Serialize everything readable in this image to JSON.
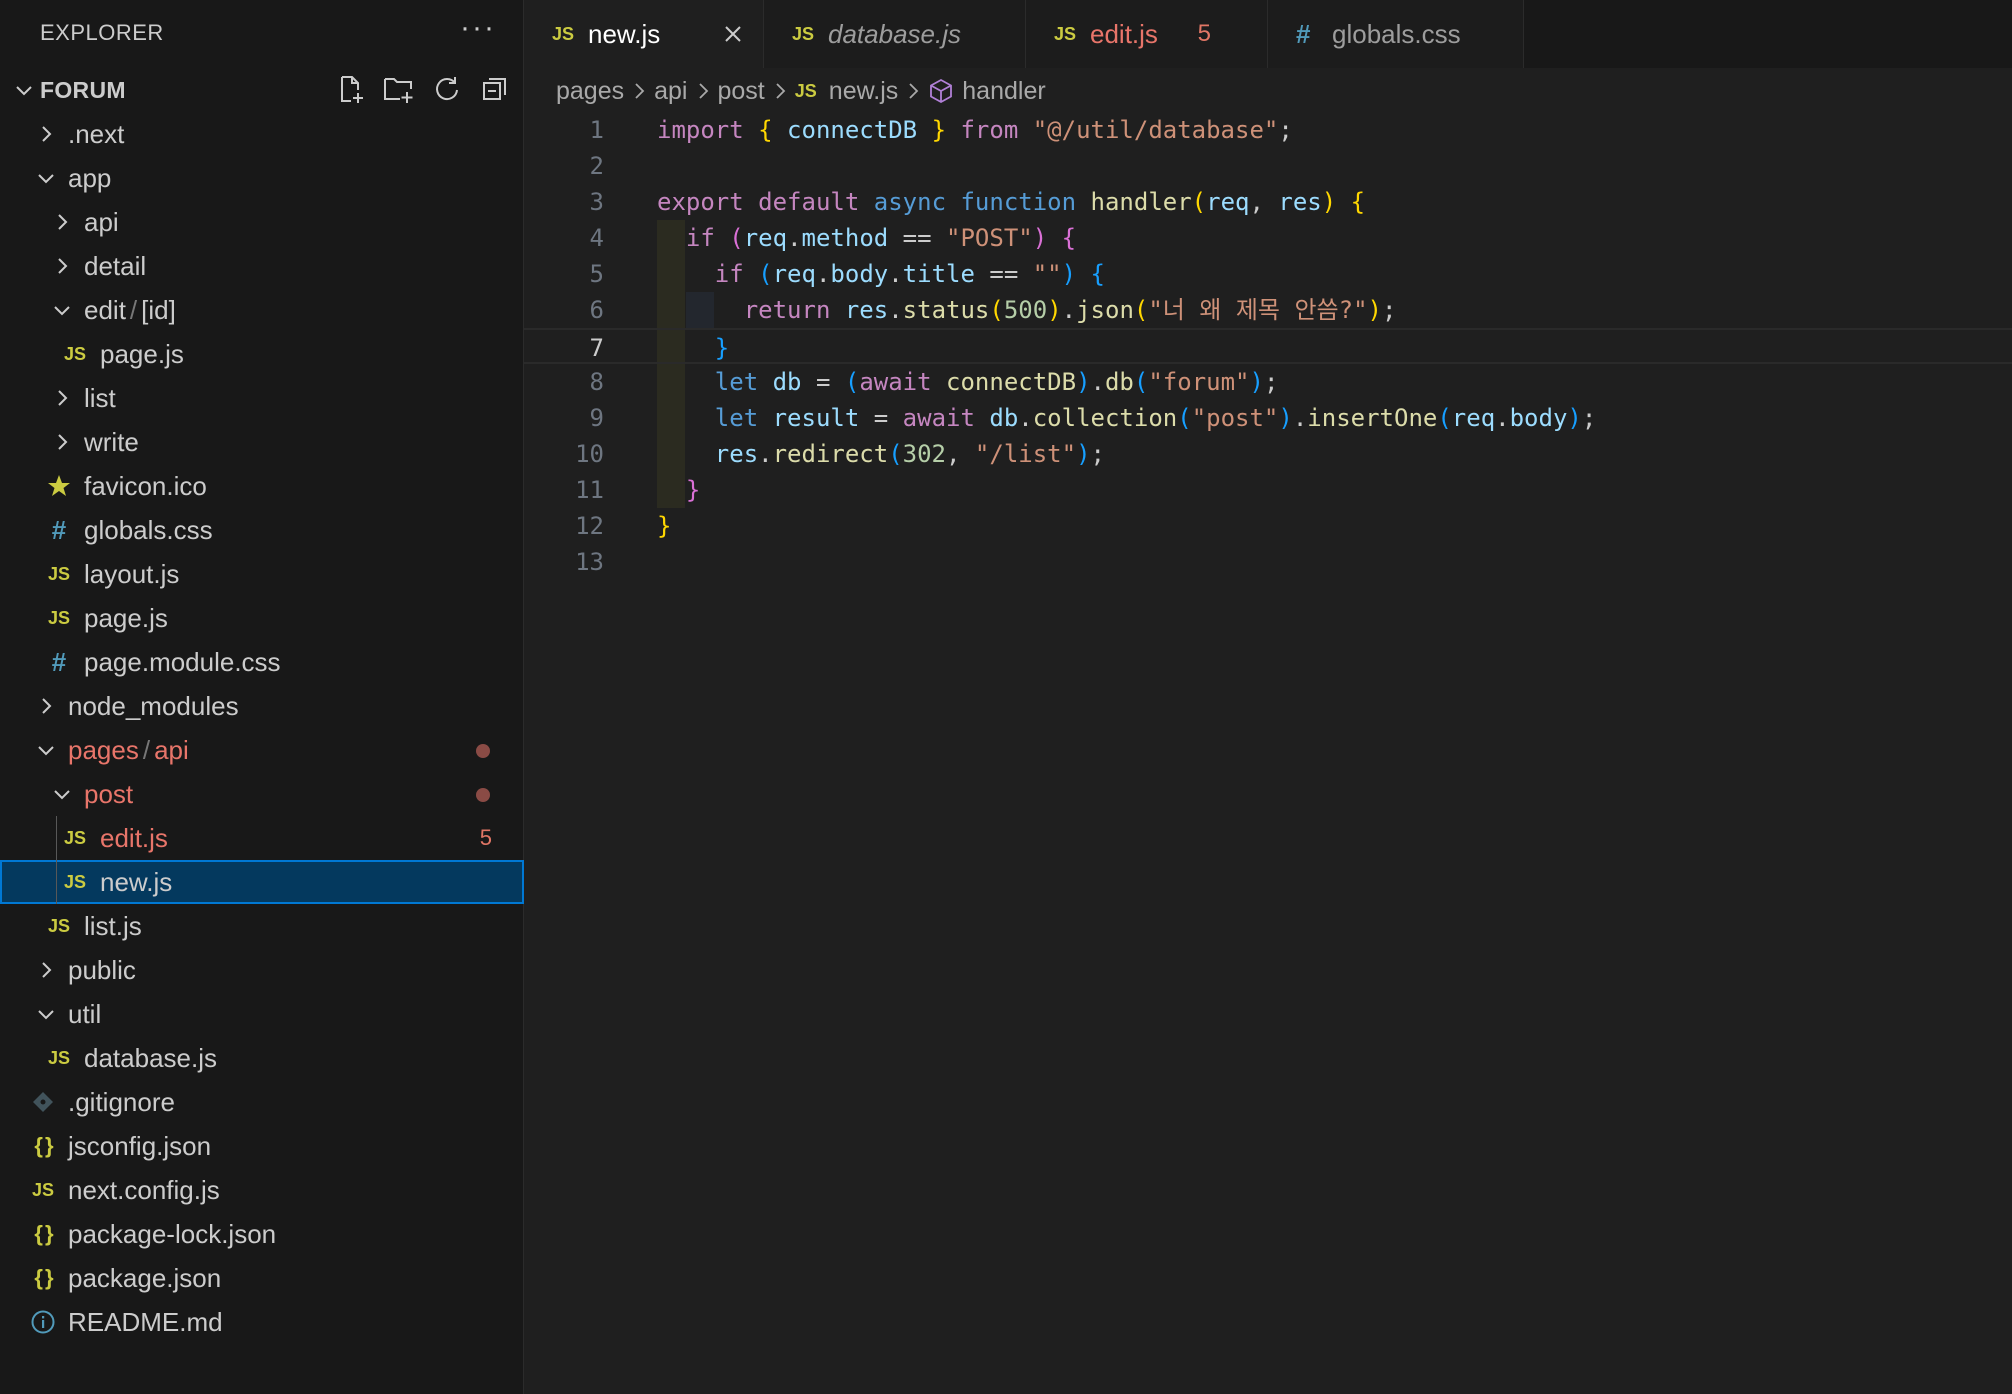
{
  "explorer": {
    "title": "EXPLORER",
    "more": "···",
    "workspace": "FORUM",
    "tree": [
      {
        "label": ".next",
        "type": "folder",
        "expanded": false,
        "depth": 0
      },
      {
        "label": "app",
        "type": "folder",
        "expanded": true,
        "depth": 0
      },
      {
        "label": "api",
        "type": "folder",
        "expanded": false,
        "depth": 1
      },
      {
        "label": "detail",
        "type": "folder",
        "expanded": false,
        "depth": 1
      },
      {
        "label": "edit",
        "label2": "[id]",
        "sep": "/",
        "type": "folder",
        "expanded": true,
        "depth": 1
      },
      {
        "label": "page.js",
        "type": "js",
        "depth": 2
      },
      {
        "label": "list",
        "type": "folder",
        "expanded": false,
        "depth": 1
      },
      {
        "label": "write",
        "type": "folder",
        "expanded": false,
        "depth": 1
      },
      {
        "label": "favicon.ico",
        "type": "ico",
        "depth": 1
      },
      {
        "label": "globals.css",
        "type": "css",
        "depth": 1
      },
      {
        "label": "layout.js",
        "type": "js",
        "depth": 1
      },
      {
        "label": "page.js",
        "type": "js",
        "depth": 1
      },
      {
        "label": "page.module.css",
        "type": "css",
        "depth": 1
      },
      {
        "label": "node_modules",
        "type": "folder",
        "expanded": false,
        "depth": 0
      },
      {
        "label": "pages",
        "label2": "api",
        "sep": "/",
        "type": "folder",
        "expanded": true,
        "depth": 0,
        "error": true,
        "dot": true
      },
      {
        "label": "post",
        "type": "folder",
        "expanded": true,
        "depth": 1,
        "error": true,
        "dot": true
      },
      {
        "label": "edit.js",
        "type": "js",
        "depth": 2,
        "error": true,
        "badge": "5"
      },
      {
        "label": "new.js",
        "type": "js",
        "depth": 2,
        "selected": true
      },
      {
        "label": "list.js",
        "type": "js",
        "depth": 1
      },
      {
        "label": "public",
        "type": "folder",
        "expanded": false,
        "depth": 0
      },
      {
        "label": "util",
        "type": "folder",
        "expanded": true,
        "depth": 0
      },
      {
        "label": "database.js",
        "type": "js",
        "depth": 1
      },
      {
        "label": ".gitignore",
        "type": "git",
        "depth": 0
      },
      {
        "label": "jsconfig.json",
        "type": "json",
        "depth": 0
      },
      {
        "label": "next.config.js",
        "type": "js",
        "depth": 0
      },
      {
        "label": "package-lock.json",
        "type": "json",
        "depth": 0
      },
      {
        "label": "package.json",
        "type": "json",
        "depth": 0
      },
      {
        "label": "README.md",
        "type": "info",
        "depth": 0
      }
    ]
  },
  "tabs": [
    {
      "label": "new.js",
      "icon": "JS",
      "active": true
    },
    {
      "label": "database.js",
      "icon": "JS",
      "italic": true
    },
    {
      "label": "edit.js",
      "icon": "JS",
      "error": true,
      "badge": "5"
    },
    {
      "label": "globals.css",
      "icon": "#"
    }
  ],
  "breadcrumb": [
    "pages",
    "api",
    "post",
    "new.js",
    "handler"
  ],
  "icons": {
    "js": "JS",
    "css": "#",
    "json": "{ }"
  },
  "colors": {
    "js_icon": "#cbcb41",
    "css_icon": "#519aba",
    "error": "#e17665",
    "selection": "#04395e",
    "focus_border": "#0078d4"
  },
  "editor": {
    "current_line": 7,
    "lines": [
      {
        "n": "1",
        "tokens": [
          [
            "import",
            "kw"
          ],
          [
            " ",
            "pl"
          ],
          [
            "{",
            "p1"
          ],
          [
            " connectDB ",
            "vr"
          ],
          [
            "}",
            "p1"
          ],
          [
            " ",
            "pl"
          ],
          [
            "from",
            "kw"
          ],
          [
            " ",
            "pl"
          ],
          [
            "\"@/util/database\"",
            "str"
          ],
          [
            ";",
            "pl"
          ]
        ]
      },
      {
        "n": "2",
        "tokens": []
      },
      {
        "n": "3",
        "tokens": [
          [
            "export",
            "kw"
          ],
          [
            " ",
            "pl"
          ],
          [
            "default",
            "kw"
          ],
          [
            " ",
            "pl"
          ],
          [
            "async",
            "kb"
          ],
          [
            " ",
            "pl"
          ],
          [
            "function",
            "kb"
          ],
          [
            " ",
            "pl"
          ],
          [
            "handler",
            "fn"
          ],
          [
            "(",
            "p1"
          ],
          [
            "req",
            "vr"
          ],
          [
            ", ",
            "pl"
          ],
          [
            "res",
            "vr"
          ],
          [
            ")",
            "p1"
          ],
          [
            " ",
            "pl"
          ],
          [
            "{",
            "p1"
          ]
        ]
      },
      {
        "n": "4",
        "tokens": [
          [
            "  ",
            "pl"
          ],
          [
            "if",
            "kw"
          ],
          [
            " ",
            "pl"
          ],
          [
            "(",
            "p2"
          ],
          [
            "req",
            "vr"
          ],
          [
            ".",
            "pl"
          ],
          [
            "method",
            "vr"
          ],
          [
            " == ",
            "pl"
          ],
          [
            "\"POST\"",
            "str"
          ],
          [
            ")",
            "p2"
          ],
          [
            " ",
            "pl"
          ],
          [
            "{",
            "p2"
          ]
        ]
      },
      {
        "n": "5",
        "tokens": [
          [
            "    ",
            "pl"
          ],
          [
            "if",
            "kw"
          ],
          [
            " ",
            "pl"
          ],
          [
            "(",
            "p3"
          ],
          [
            "req",
            "vr"
          ],
          [
            ".",
            "pl"
          ],
          [
            "body",
            "vr"
          ],
          [
            ".",
            "pl"
          ],
          [
            "title",
            "vr"
          ],
          [
            " == ",
            "pl"
          ],
          [
            "\"\"",
            "str"
          ],
          [
            ")",
            "p3"
          ],
          [
            " ",
            "pl"
          ],
          [
            "{",
            "p3"
          ]
        ]
      },
      {
        "n": "6",
        "tokens": [
          [
            "      ",
            "pl"
          ],
          [
            "return",
            "kw"
          ],
          [
            " ",
            "pl"
          ],
          [
            "res",
            "vr"
          ],
          [
            ".",
            "pl"
          ],
          [
            "status",
            "fn"
          ],
          [
            "(",
            "p1"
          ],
          [
            "500",
            "num"
          ],
          [
            ")",
            "p1"
          ],
          [
            ".",
            "pl"
          ],
          [
            "json",
            "fn"
          ],
          [
            "(",
            "p1"
          ],
          [
            "\"너 왜 제목 안씀?\"",
            "str"
          ],
          [
            ")",
            "p1"
          ],
          [
            ";",
            "pl"
          ]
        ]
      },
      {
        "n": "7",
        "tokens": [
          [
            "    ",
            "pl"
          ],
          [
            "}",
            "p3"
          ]
        ]
      },
      {
        "n": "8",
        "tokens": [
          [
            "    ",
            "pl"
          ],
          [
            "let",
            "kb"
          ],
          [
            " ",
            "pl"
          ],
          [
            "db",
            "vr"
          ],
          [
            " = ",
            "pl"
          ],
          [
            "(",
            "p3"
          ],
          [
            "await",
            "kw"
          ],
          [
            " ",
            "pl"
          ],
          [
            "connectDB",
            "fn"
          ],
          [
            ")",
            "p3"
          ],
          [
            ".",
            "pl"
          ],
          [
            "db",
            "fn"
          ],
          [
            "(",
            "p3"
          ],
          [
            "\"forum\"",
            "str"
          ],
          [
            ")",
            "p3"
          ],
          [
            ";",
            "pl"
          ]
        ]
      },
      {
        "n": "9",
        "tokens": [
          [
            "    ",
            "pl"
          ],
          [
            "let",
            "kb"
          ],
          [
            " ",
            "pl"
          ],
          [
            "result",
            "vr"
          ],
          [
            " = ",
            "pl"
          ],
          [
            "await",
            "kw"
          ],
          [
            " ",
            "pl"
          ],
          [
            "db",
            "vr"
          ],
          [
            ".",
            "pl"
          ],
          [
            "collection",
            "fn"
          ],
          [
            "(",
            "p3"
          ],
          [
            "\"post\"",
            "str"
          ],
          [
            ")",
            "p3"
          ],
          [
            ".",
            "pl"
          ],
          [
            "insertOne",
            "fn"
          ],
          [
            "(",
            "p3"
          ],
          [
            "req",
            "vr"
          ],
          [
            ".",
            "pl"
          ],
          [
            "body",
            "vr"
          ],
          [
            ")",
            "p3"
          ],
          [
            ";",
            "pl"
          ]
        ]
      },
      {
        "n": "10",
        "tokens": [
          [
            "    ",
            "pl"
          ],
          [
            "res",
            "vr"
          ],
          [
            ".",
            "pl"
          ],
          [
            "redirect",
            "fn"
          ],
          [
            "(",
            "p3"
          ],
          [
            "302",
            "num"
          ],
          [
            ", ",
            "pl"
          ],
          [
            "\"/list\"",
            "str"
          ],
          [
            ")",
            "p3"
          ],
          [
            ";",
            "pl"
          ]
        ]
      },
      {
        "n": "11",
        "tokens": [
          [
            "  ",
            "pl"
          ],
          [
            "}",
            "p2"
          ]
        ]
      },
      {
        "n": "12",
        "tokens": [
          [
            "}",
            "p1"
          ]
        ]
      },
      {
        "n": "13",
        "tokens": []
      }
    ]
  }
}
